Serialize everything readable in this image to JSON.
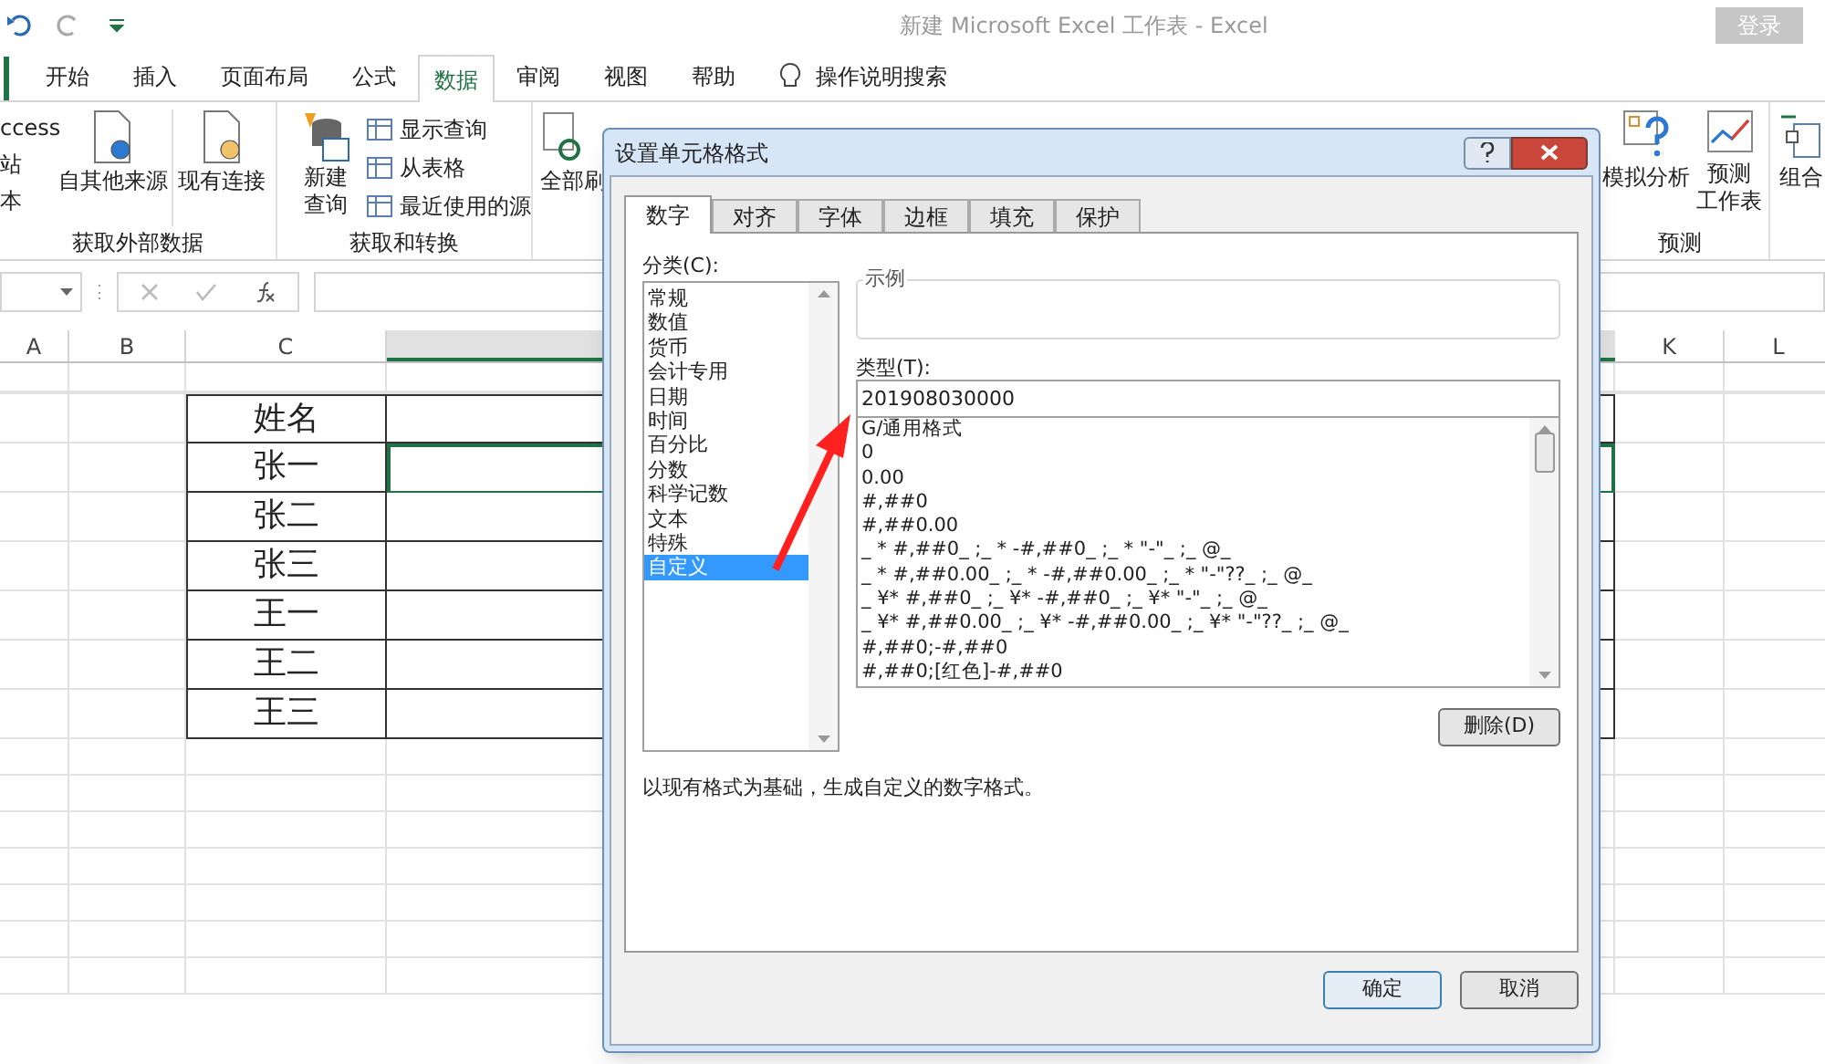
{
  "title_bar": {
    "title": "新建 Microsoft Excel 工作表  -  Excel",
    "sign_in": "登录"
  },
  "ribbon_tabs": [
    {
      "label": "开始",
      "selected": false
    },
    {
      "label": "插入",
      "selected": false
    },
    {
      "label": "页面布局",
      "selected": false
    },
    {
      "label": "公式",
      "selected": false
    },
    {
      "label": "数据",
      "selected": true
    },
    {
      "label": "审阅",
      "selected": false
    },
    {
      "label": "视图",
      "selected": false
    },
    {
      "label": "帮助",
      "selected": false
    }
  ],
  "tell_me": "操作说明搜索",
  "ribbon": {
    "external_lines": [
      "ccess",
      "站",
      "本"
    ],
    "from_other": "自其他来源",
    "existing": "现有连接",
    "external_label": "获取外部数据",
    "new_query": [
      "新建",
      "查询"
    ],
    "query_items": [
      "显示查询",
      "从表格",
      "最近使用的源"
    ],
    "transform_label": "获取和转换",
    "refresh": "全部刷",
    "what_if": "模拟分析",
    "forecast_sheet": [
      "预测",
      "工作表"
    ],
    "forecast_label": "预测",
    "group": "组合"
  },
  "columns": [
    {
      "label": "A",
      "selected": false
    },
    {
      "label": "B",
      "selected": false
    },
    {
      "label": "C",
      "selected": false
    },
    {
      "selected": true
    },
    {
      "label": "K",
      "selected": false
    },
    {
      "label": "L",
      "selected": false
    }
  ],
  "rows": [
    {
      "name": "姓名",
      "selected": false
    },
    {
      "name": "张一",
      "selected": true
    },
    {
      "name": "张二",
      "selected": false
    },
    {
      "name": "张三",
      "selected": false
    },
    {
      "name": "王一",
      "selected": false
    },
    {
      "name": "王二",
      "selected": false
    },
    {
      "name": "王三",
      "selected": false
    }
  ],
  "dialog": {
    "title": "设置单元格格式",
    "tabs": [
      {
        "label": "数字",
        "selected": true
      },
      {
        "label": "对齐",
        "selected": false
      },
      {
        "label": "字体",
        "selected": false
      },
      {
        "label": "边框",
        "selected": false
      },
      {
        "label": "填充",
        "selected": false
      },
      {
        "label": "保护",
        "selected": false
      }
    ],
    "category_label": "分类(C):",
    "categories": [
      {
        "label": "常规",
        "selected": false
      },
      {
        "label": "数值",
        "selected": false
      },
      {
        "label": "货币",
        "selected": false
      },
      {
        "label": "会计专用",
        "selected": false
      },
      {
        "label": "日期",
        "selected": false
      },
      {
        "label": "时间",
        "selected": false
      },
      {
        "label": "百分比",
        "selected": false
      },
      {
        "label": "分数",
        "selected": false
      },
      {
        "label": "科学记数",
        "selected": false
      },
      {
        "label": "文本",
        "selected": false
      },
      {
        "label": "特殊",
        "selected": false
      },
      {
        "label": "自定义",
        "selected": true
      }
    ],
    "sample_label": "示例",
    "type_label": "类型(T):",
    "type_value": "201908030000",
    "formats": [
      "G/通用格式",
      "0",
      "0.00",
      "#,##0",
      "#,##0.00",
      "_ * #,##0_ ;_ * -#,##0_ ;_ * \"-\"_ ;_ @_",
      "_ * #,##0.00_ ;_ * -#,##0.00_ ;_ * \"-\"??_ ;_ @_",
      "_ ¥* #,##0_ ;_ ¥* -#,##0_ ;_ ¥* \"-\"_ ;_ @_",
      "_ ¥* #,##0.00_ ;_ ¥* -#,##0.00_ ;_ ¥* \"-\"??_ ;_ @_",
      "#,##0;-#,##0",
      "#,##0;[红色]-#,##0"
    ],
    "delete": "删除(D)",
    "description": "以现有格式为基础，生成自定义的数字格式。",
    "ok": "确定",
    "cancel": "取消"
  }
}
